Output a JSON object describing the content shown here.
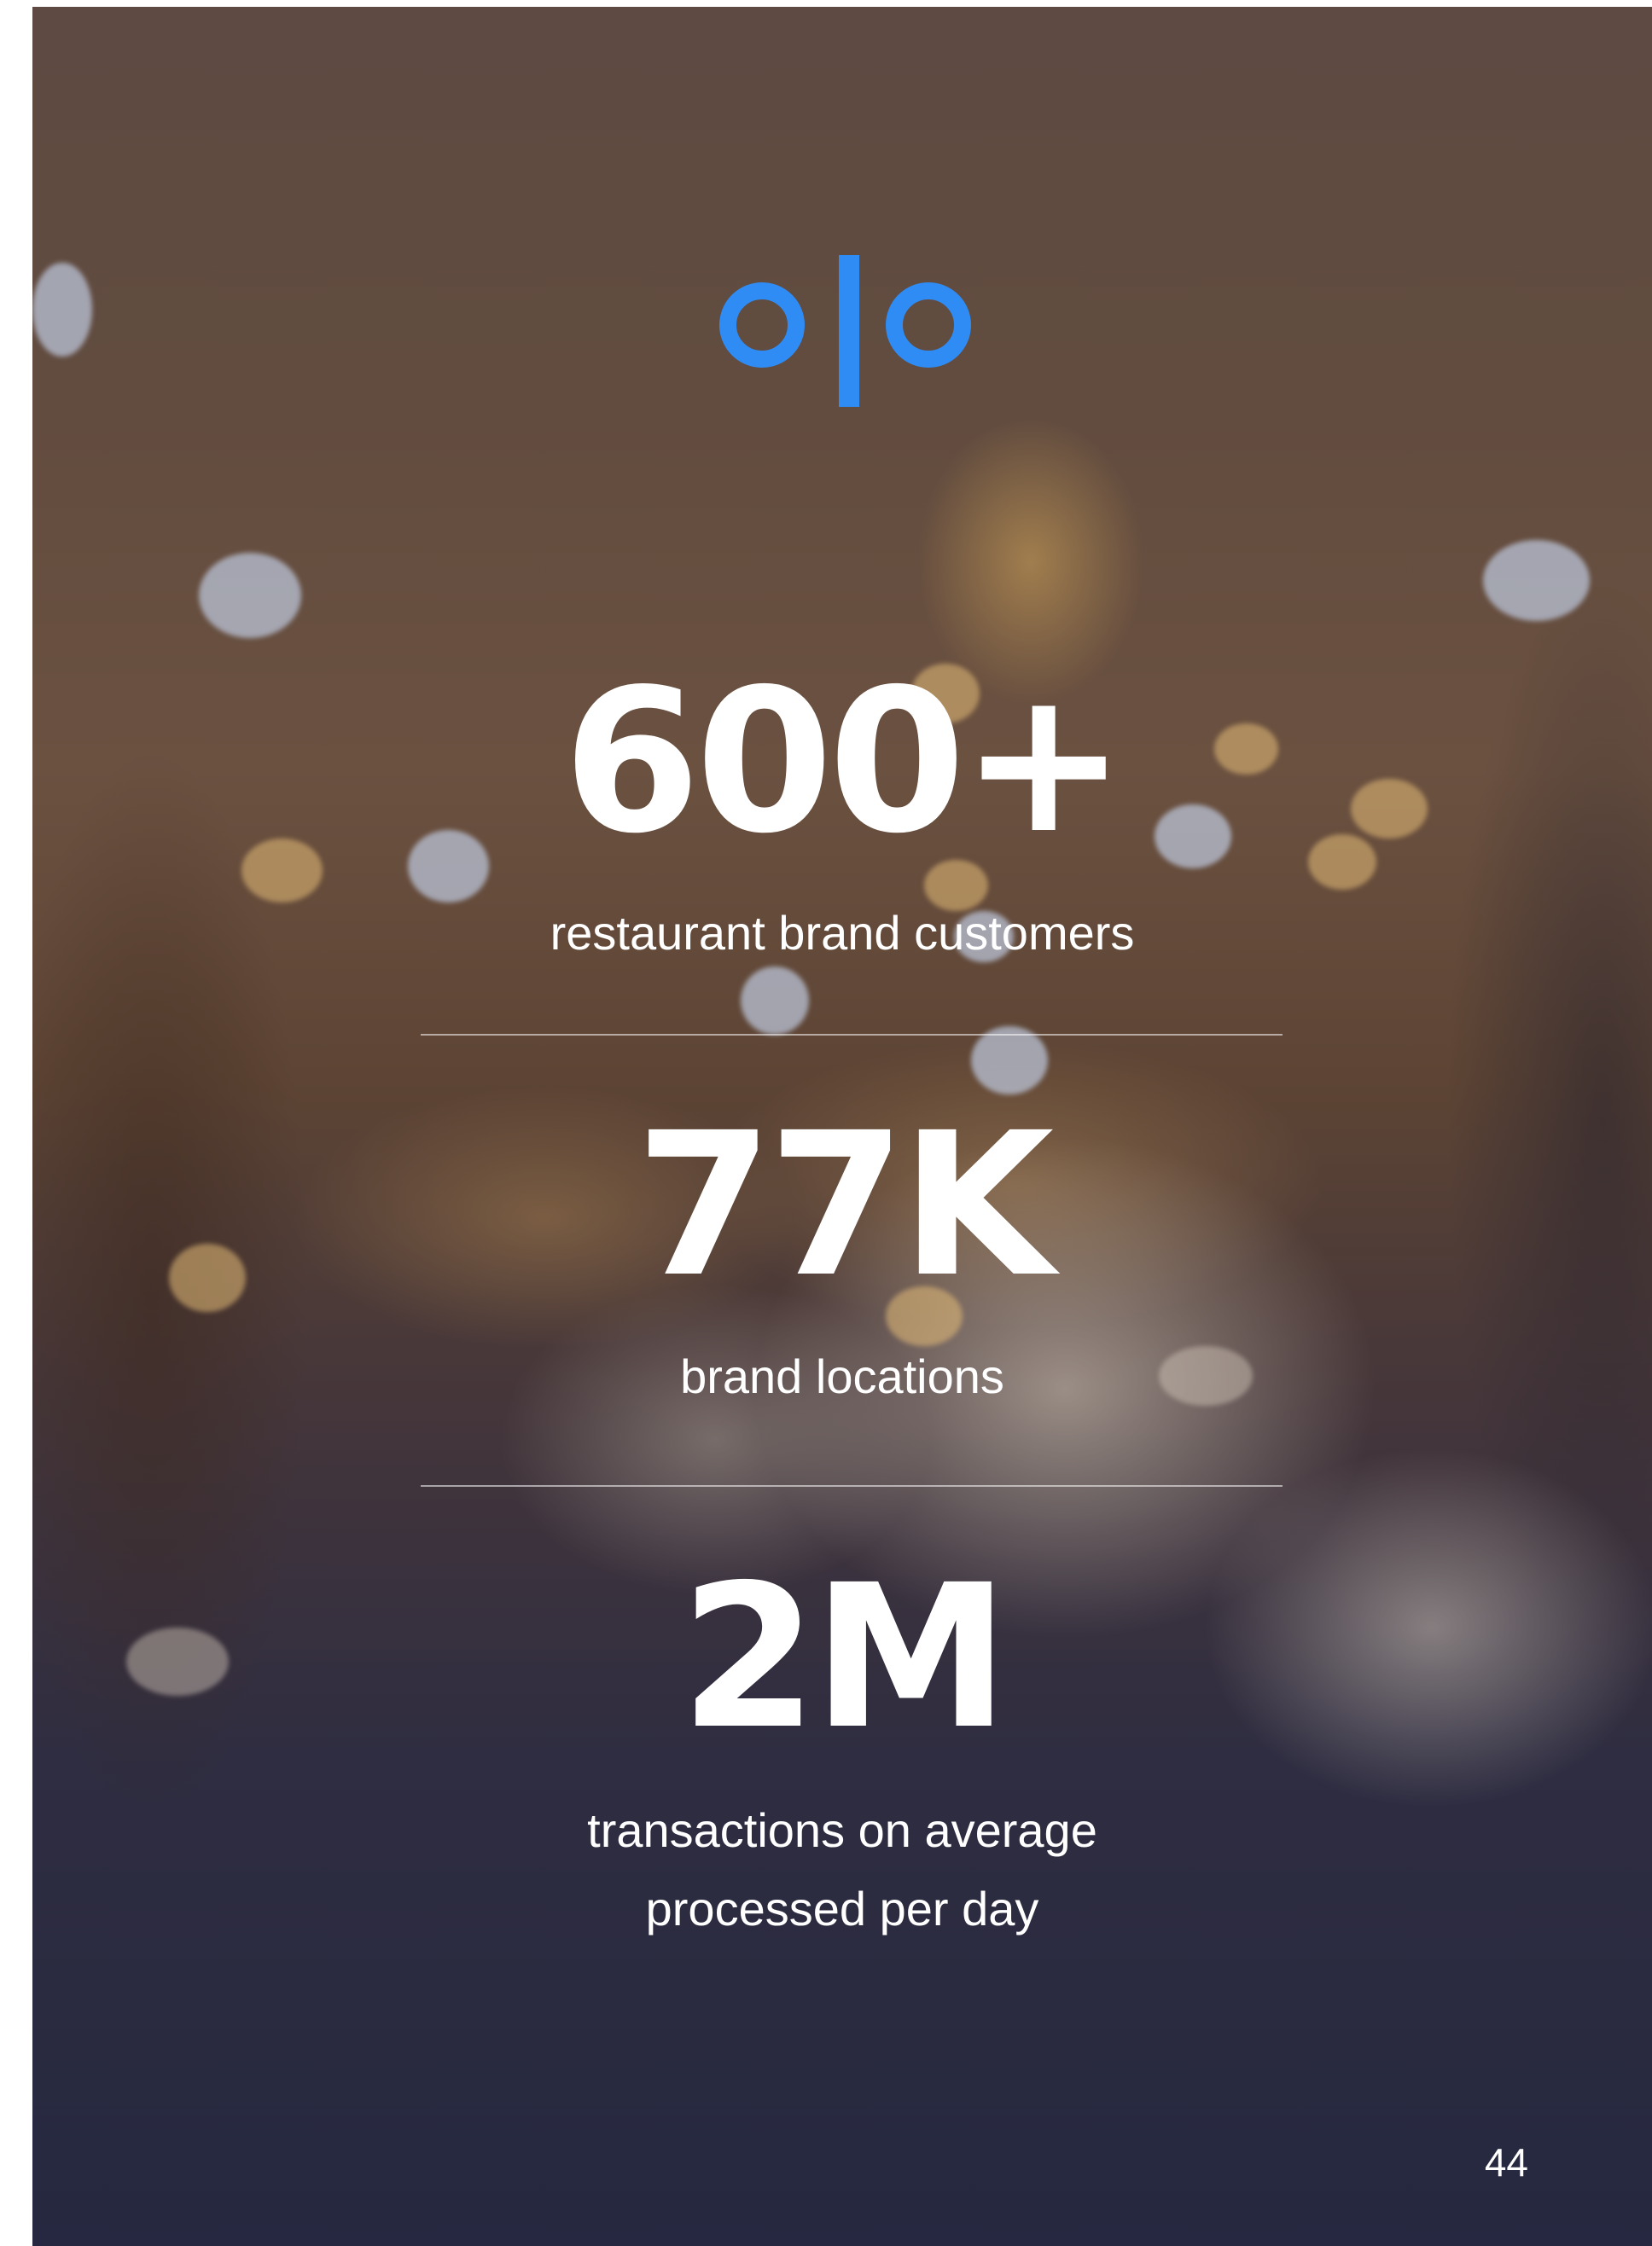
{
  "brand": {
    "logo_text": "olo",
    "logo_color": "#2f8cf5"
  },
  "stats": [
    {
      "value": "600+",
      "label": "restaurant brand customers"
    },
    {
      "value": "77K",
      "label": "brand locations"
    },
    {
      "value": "2M",
      "label_line1": "transactions on average",
      "label_line2": "processed per day"
    }
  ],
  "page_number": "44"
}
